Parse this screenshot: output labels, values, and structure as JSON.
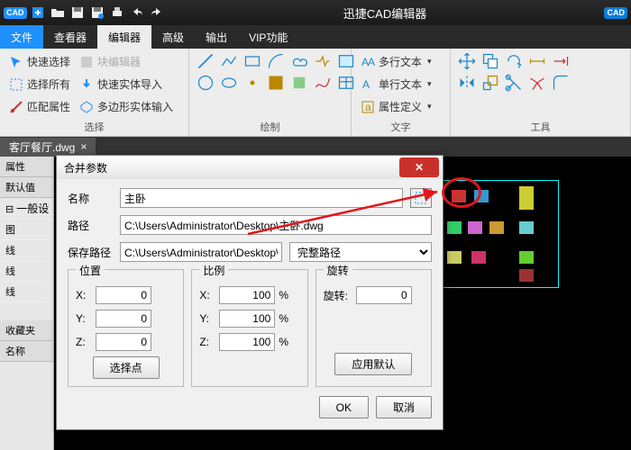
{
  "app": {
    "title": "迅捷CAD编辑器",
    "badge": "CAD"
  },
  "menu": {
    "file": "文件",
    "viewer": "查看器",
    "editor": "编辑器",
    "advanced": "高级",
    "output": "输出",
    "vip": "VIP功能"
  },
  "ribbon": {
    "select": {
      "label": "选择",
      "quick": "快速选择",
      "blockEditor": "块编辑器",
      "selectAll": "选择所有",
      "entityImport": "快速实体导入",
      "matchProp": "匹配属性",
      "polyEntity": "多边形实体输入"
    },
    "draw": {
      "label": "绘制"
    },
    "text": {
      "label": "文字",
      "mtext": "多行文本",
      "stext": "单行文本",
      "attr": "属性定义"
    },
    "tool": {
      "label": "工具"
    }
  },
  "docTab": "客厅餐厅.dwg",
  "side": {
    "attr": "属性",
    "default": "默认值",
    "general": "一般设",
    "fav": "收藏夹",
    "name": "名称",
    "r1": "图",
    "r2": "线",
    "r3": "线",
    "r4": "线"
  },
  "dlg": {
    "title": "合并参数",
    "name": {
      "label": "名称",
      "value": "主卧"
    },
    "path": {
      "label": "路径",
      "value": "C:\\Users\\Administrator\\Desktop\\主卧.dwg"
    },
    "savePath": {
      "label": "保存路径",
      "value": "C:\\Users\\Administrator\\Desktop\\主卧",
      "mode": "完整路径"
    },
    "pos": {
      "label": "位置",
      "x": "0",
      "y": "0",
      "z": "0",
      "pick": "选择点"
    },
    "scale": {
      "label": "比例",
      "x": "100",
      "y": "100",
      "z": "100",
      "pct": "%"
    },
    "rot": {
      "label": "旋转",
      "rlabel": "旋转:",
      "value": "0",
      "apply": "应用默认"
    },
    "ok": "OK",
    "cancel": "取消",
    "xyz": {
      "x": "X:",
      "y": "Y:",
      "z": "Z:"
    }
  }
}
